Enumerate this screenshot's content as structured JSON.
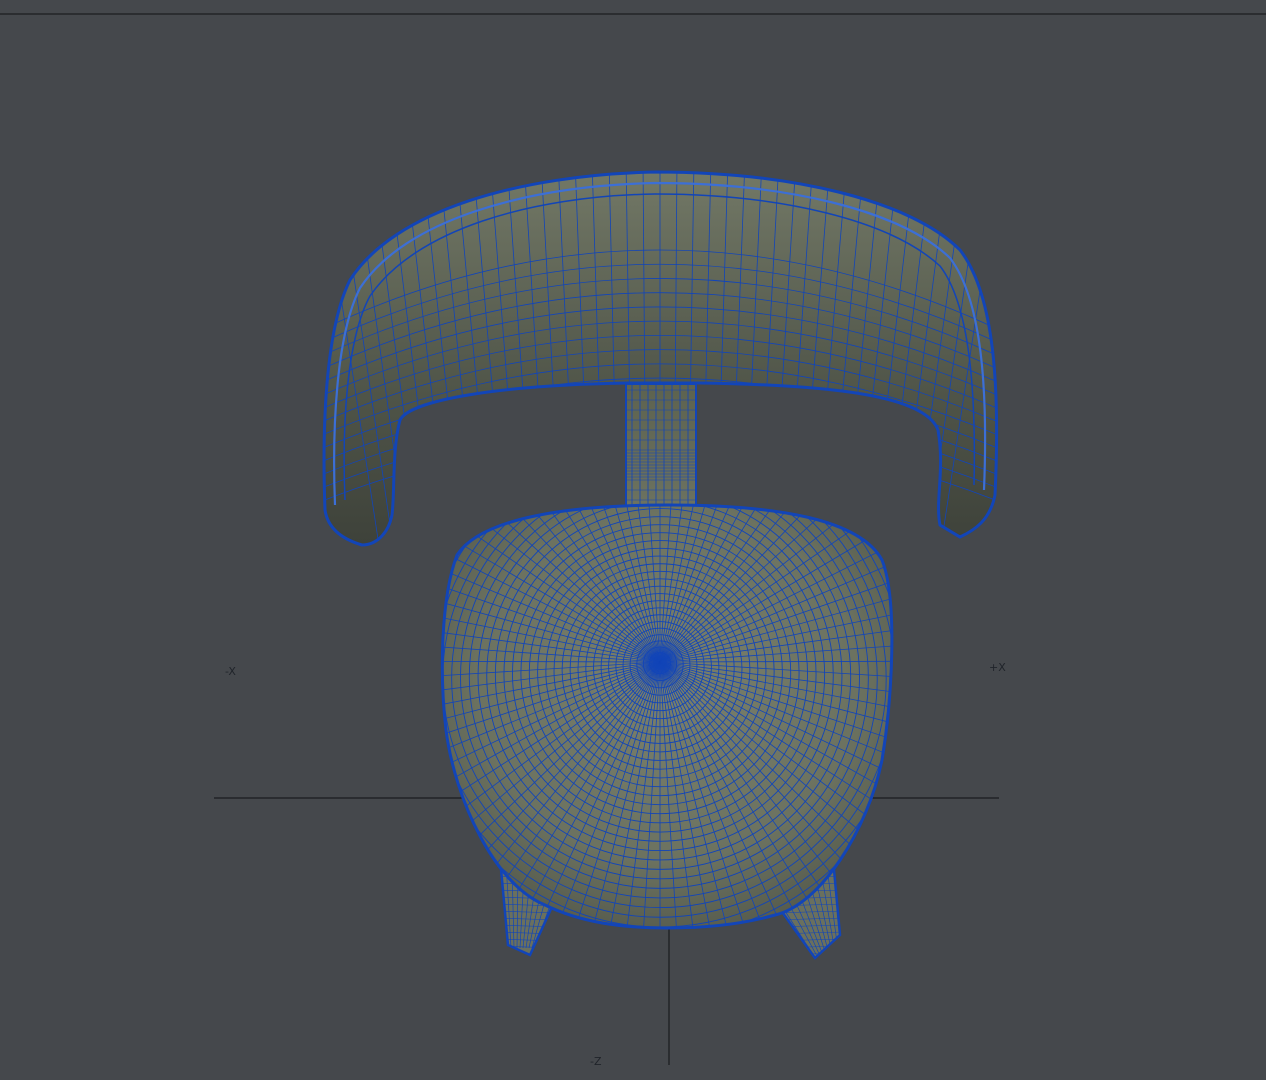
{
  "viewport": {
    "view": "top",
    "background_color": "#45484c",
    "wire_color": "#1245b8",
    "surface_color": "#6e7462",
    "axis_color": "#1a1c1f"
  },
  "axes": {
    "neg_x": "-X",
    "pos_x": "+X",
    "neg_z": "-Z"
  },
  "model": {
    "object": "chair",
    "display_mode": "wireframe-on-shaded"
  }
}
